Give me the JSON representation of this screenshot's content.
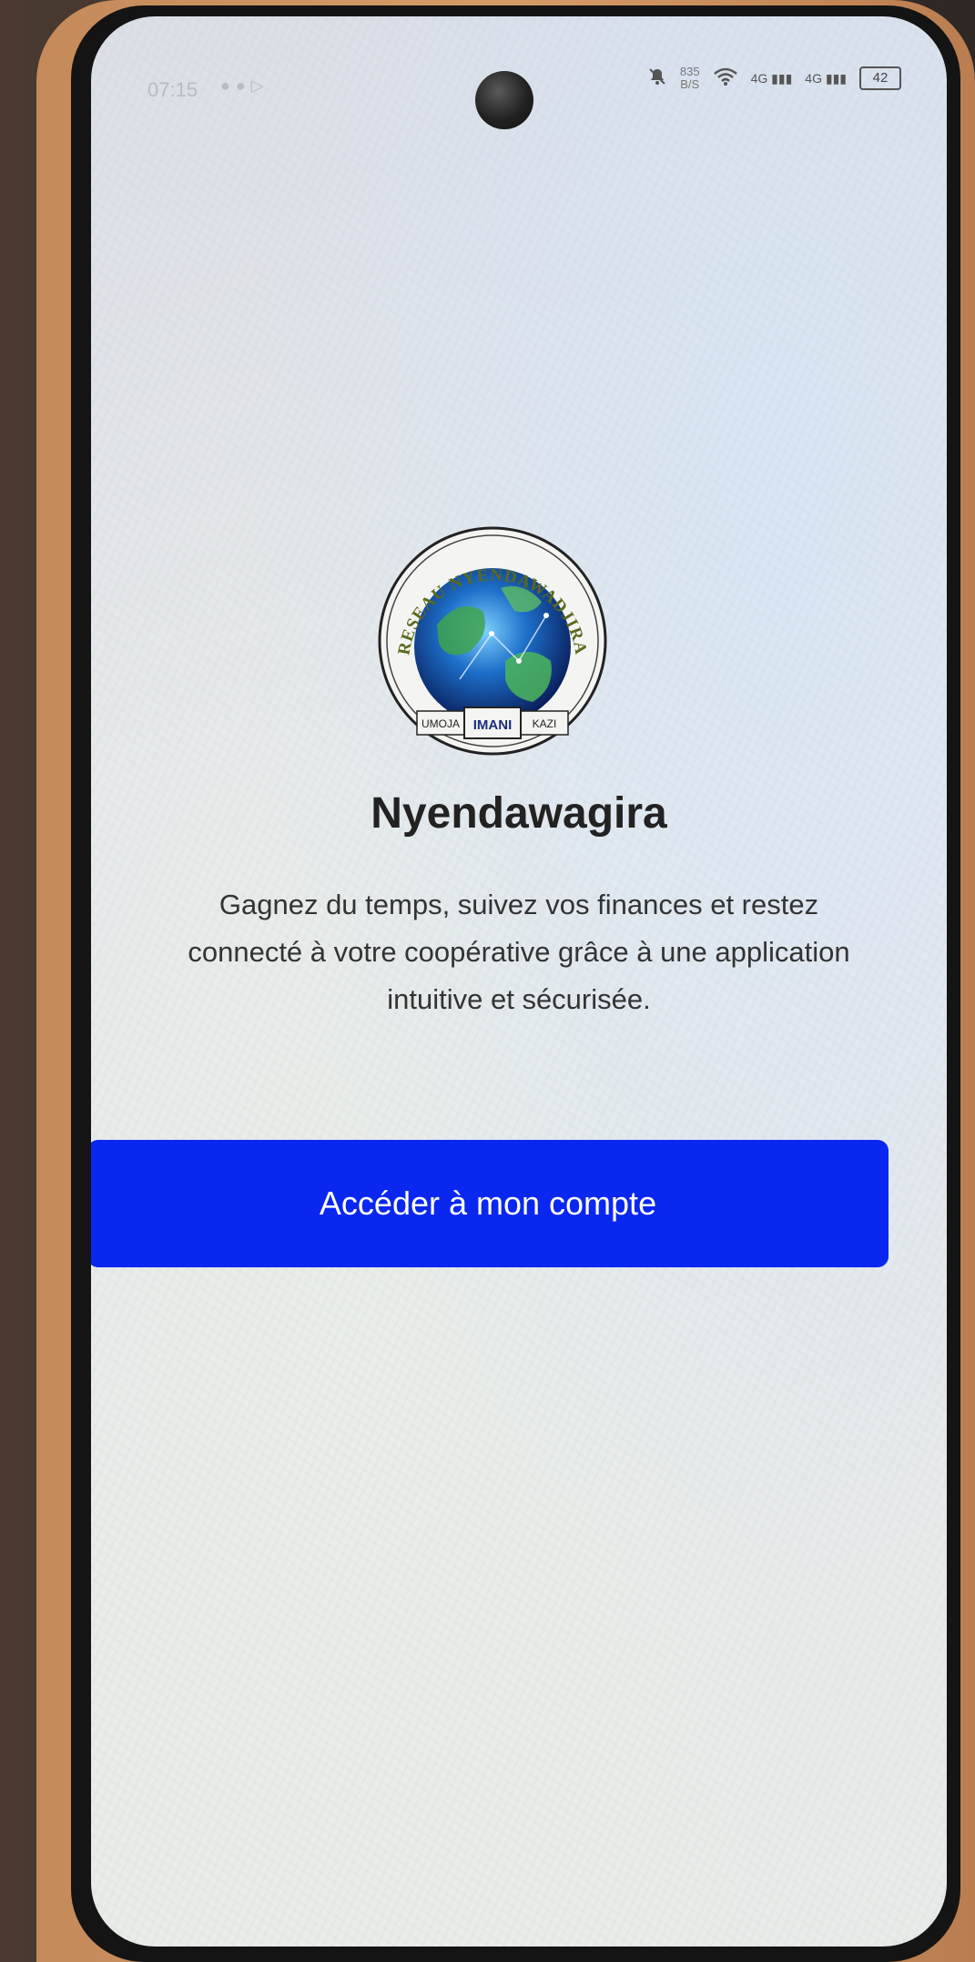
{
  "status_bar": {
    "time": "07:15",
    "network_speed_value": "835",
    "network_speed_unit": "B/S",
    "sim1_label": "4G",
    "sim2_label": "4G",
    "battery_level": "42"
  },
  "logo": {
    "ring_text_top": "RESEAU NYENDAWADJIRA",
    "banner_left": "UMOJA",
    "banner_center": "IMANI",
    "banner_right": "KAZI"
  },
  "welcome": {
    "title": "Nyendawagira",
    "tagline": "Gagnez du temps, suivez vos finances et restez connecté à votre coopérative grâce à une application intuitive et sécurisée.",
    "cta_label": "Accéder à mon compte"
  },
  "colors": {
    "cta_background": "#0a27f0",
    "cta_text": "#ffffff",
    "title_text": "#222222"
  }
}
